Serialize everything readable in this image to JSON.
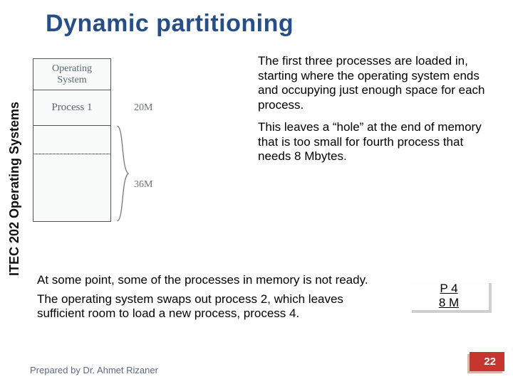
{
  "title": "Dynamic partitioning",
  "sidebar_label": "ITEC 202 Operating Systems",
  "diagram": {
    "rows": {
      "os": "Operating\nSystem",
      "p1": "Process 1"
    },
    "sizes": {
      "p1": "20M",
      "hole": "36M"
    }
  },
  "paras": {
    "r1": "The first three processes are loaded in, starting where the operating system ends and occupying just enough space for each process.",
    "r2": "This leaves a “hole” at the end of memory that is too small for fourth process that needs 8 Mbytes.",
    "b1": "At some point, some of the processes in memory is not ready.",
    "b2": "The operating system swaps out process 2, which leaves sufficient room to load a new process, process 4."
  },
  "p4box": {
    "line1": "P 4",
    "line2": "8 M"
  },
  "footer": "Prepared by Dr. Ahmet Rizaner",
  "page": "22"
}
